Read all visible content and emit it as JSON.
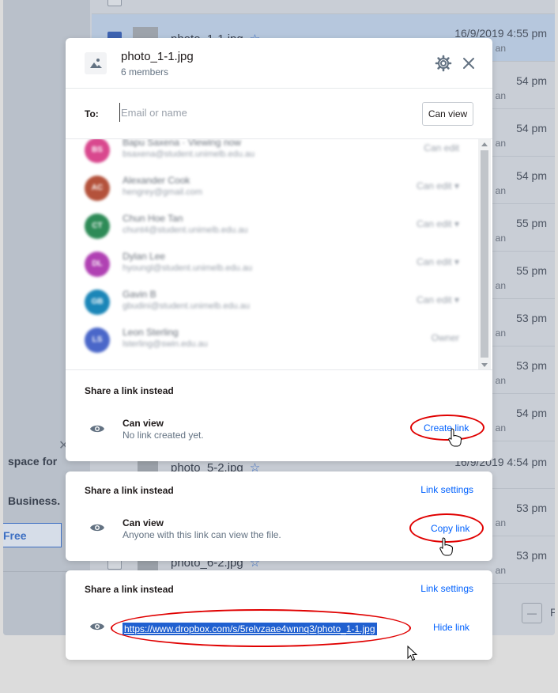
{
  "background": {
    "rows": [
      {
        "date": "16/9/2019 4:55 pm",
        "file": "photo_1-1.jpg"
      },
      {
        "date": "54 pm"
      },
      {
        "date": "54 pm"
      },
      {
        "date": "54 pm"
      },
      {
        "date": "55 pm"
      },
      {
        "date": "55 pm"
      },
      {
        "date": "53 pm"
      },
      {
        "date": "53 pm"
      },
      {
        "date": "54 pm",
        "file": ""
      },
      {
        "date": "16/9/2019 4:54 pm",
        "file": "photo_5-2.jpg"
      },
      {
        "date": "53 pm"
      },
      {
        "date": "53 pm",
        "file": "photo_6-2.jpg"
      }
    ],
    "sub_label": "an",
    "upsell_space": "space for",
    "upsell_business": "Business.",
    "upsell_button": "Free",
    "pager_label": "P"
  },
  "modal": {
    "file_name": "photo_1-1.jpg",
    "members_count": "6 members",
    "to_label": "To:",
    "to_placeholder": "Email or name",
    "permission_button": "Can view",
    "members": [
      {
        "initials": "BS",
        "name": "Bapu Saxena   ·   Viewing now",
        "email": "bsaxena@student.unimelb.edu.au",
        "role": "Can edit",
        "color": "#d9488e"
      },
      {
        "initials": "AC",
        "name": "Alexander Cook",
        "email": "hengrey@gmail.com",
        "role": "Can edit  ▾",
        "color": "#b4523b"
      },
      {
        "initials": "CT",
        "name": "Chun Hoe Tan",
        "email": "chunt4@student.unimelb.edu.au",
        "role": "Can edit  ▾",
        "color": "#2e8b57"
      },
      {
        "initials": "DL",
        "name": "Dylan Lee",
        "email": "hyoungl@student.unimelb.edu.au",
        "role": "Can edit  ▾",
        "color": "#b041b3"
      },
      {
        "initials": "GB",
        "name": "Gavin B",
        "email": "gbudini@student.unimelb.edu.au",
        "role": "Can edit  ▾",
        "color": "#1b86b8"
      },
      {
        "initials": "LS",
        "name": "Leon Sterling",
        "email": "lsterling@swin.edu.au",
        "role": "Owner",
        "color": "#4a67c9"
      }
    ],
    "share_heading": "Share a link instead",
    "link_title": "Can view",
    "no_link_desc": "No link created yet.",
    "create_link": "Create link"
  },
  "card2": {
    "heading": "Share a link instead",
    "settings": "Link settings",
    "title": "Can view",
    "desc": "Anyone with this link can view the file.",
    "action": "Copy link"
  },
  "card3": {
    "heading": "Share a link instead",
    "settings": "Link settings",
    "url": "https://www.dropbox.com/s/5relvzaae4wnnq3/photo_1-1.jpg",
    "action": "Hide link"
  },
  "colors": {
    "link_blue": "#0061fe",
    "annotation_red": "#e00000",
    "selection_blue": "#2060d0"
  }
}
